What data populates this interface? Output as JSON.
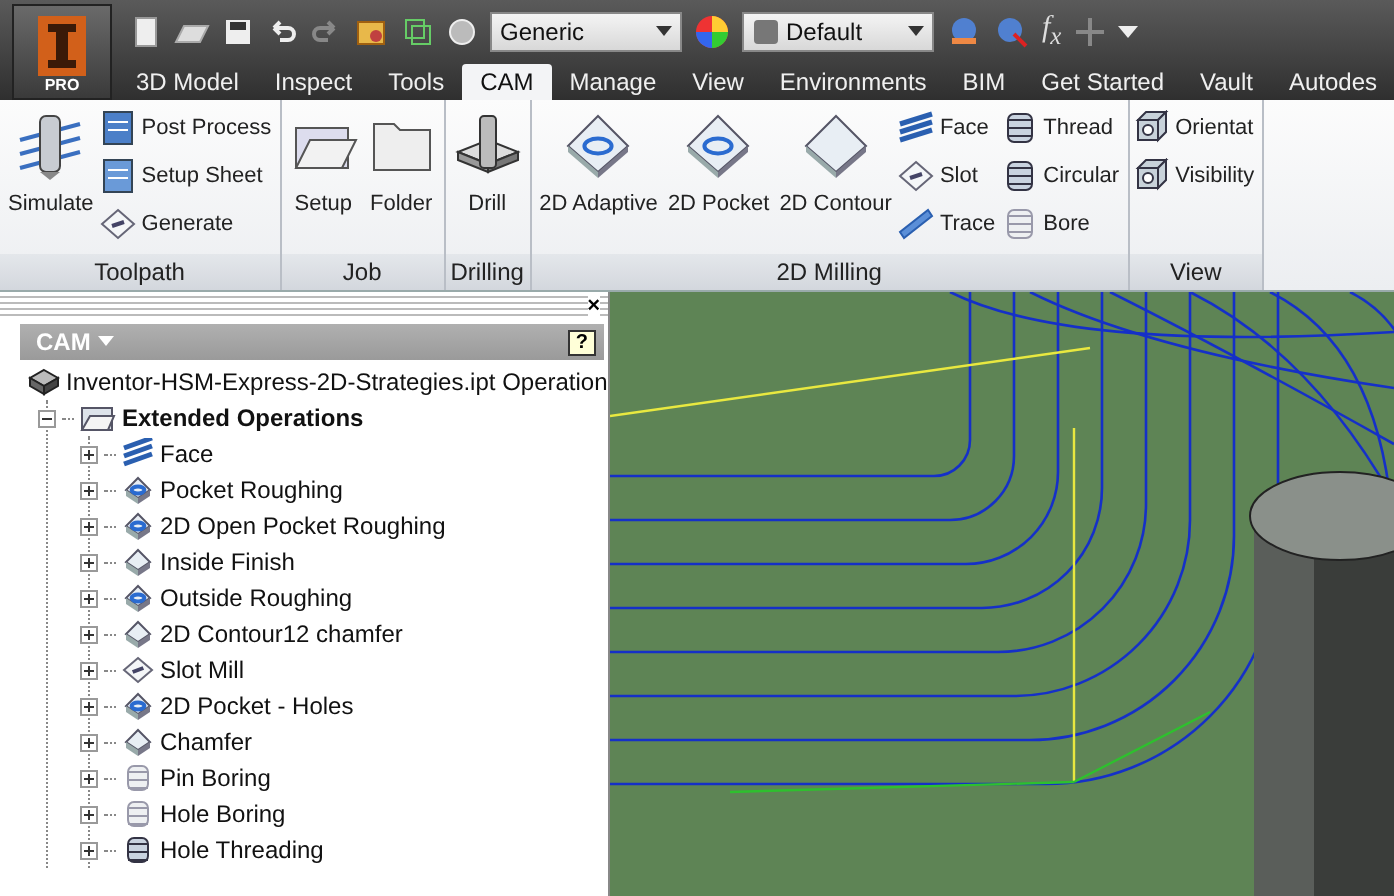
{
  "app_button": {
    "label": "PRO"
  },
  "quick_access": {
    "material": "Generic",
    "appearance": "Default",
    "function_button": "f$_{x}$"
  },
  "tabs": [
    {
      "label": "3D Model",
      "selected": false
    },
    {
      "label": "Inspect",
      "selected": false
    },
    {
      "label": "Tools",
      "selected": false
    },
    {
      "label": "CAM",
      "selected": true
    },
    {
      "label": "Manage",
      "selected": false
    },
    {
      "label": "View",
      "selected": false
    },
    {
      "label": "Environments",
      "selected": false
    },
    {
      "label": "BIM",
      "selected": false
    },
    {
      "label": "Get Started",
      "selected": false
    },
    {
      "label": "Vault",
      "selected": false
    },
    {
      "label": "Autodes",
      "selected": false
    }
  ],
  "ribbon": {
    "panels": [
      {
        "title": "Toolpath",
        "buttons": [
          {
            "kind": "large",
            "label": "Simulate"
          },
          {
            "kind": "small",
            "label": "Post Process"
          },
          {
            "kind": "small",
            "label": "Setup Sheet"
          },
          {
            "kind": "small",
            "label": "Generate"
          }
        ]
      },
      {
        "title": "Job",
        "buttons": [
          {
            "kind": "large",
            "label": "Setup"
          },
          {
            "kind": "large",
            "label": "Folder"
          }
        ]
      },
      {
        "title": "Drilling",
        "buttons": [
          {
            "kind": "large",
            "label": "Drill"
          }
        ]
      },
      {
        "title": "2D Milling",
        "buttons": [
          {
            "kind": "large",
            "label": "2D Adaptive"
          },
          {
            "kind": "large",
            "label": "2D Pocket"
          },
          {
            "kind": "large",
            "label": "2D Contour"
          },
          {
            "kind": "small",
            "label": "Face"
          },
          {
            "kind": "small",
            "label": "Slot"
          },
          {
            "kind": "small",
            "label": "Trace"
          },
          {
            "kind": "small",
            "label": "Thread"
          },
          {
            "kind": "small",
            "label": "Circular"
          },
          {
            "kind": "small",
            "label": "Bore"
          }
        ]
      },
      {
        "title": "View",
        "buttons": [
          {
            "kind": "small",
            "label": "Orientat"
          },
          {
            "kind": "small",
            "label": "Visibility"
          }
        ]
      }
    ]
  },
  "browser": {
    "close": "×",
    "title": "CAM",
    "help": "?",
    "tree": [
      {
        "label": "Inventor-HSM-Express-2D-Strategies.ipt Operation",
        "children": [
          {
            "label": "Extended Operations",
            "expanded": true,
            "children": [
              {
                "label": "Face",
                "expanded": false
              },
              {
                "label": "Pocket Roughing",
                "expanded": false
              },
              {
                "label": "2D Open Pocket Roughing",
                "expanded": false
              },
              {
                "label": "Inside Finish",
                "expanded": false
              },
              {
                "label": "Outside Roughing",
                "expanded": false
              },
              {
                "label": "2D Contour12 chamfer",
                "expanded": false
              },
              {
                "label": "Slot Mill",
                "expanded": false
              },
              {
                "label": "2D Pocket - Holes",
                "expanded": false
              },
              {
                "label": "Chamfer",
                "expanded": false
              },
              {
                "label": "Pin Boring",
                "expanded": false
              },
              {
                "label": "Hole Boring",
                "expanded": false
              },
              {
                "label": "Hole Threading",
                "expanded": false
              }
            ]
          }
        ]
      }
    ]
  }
}
